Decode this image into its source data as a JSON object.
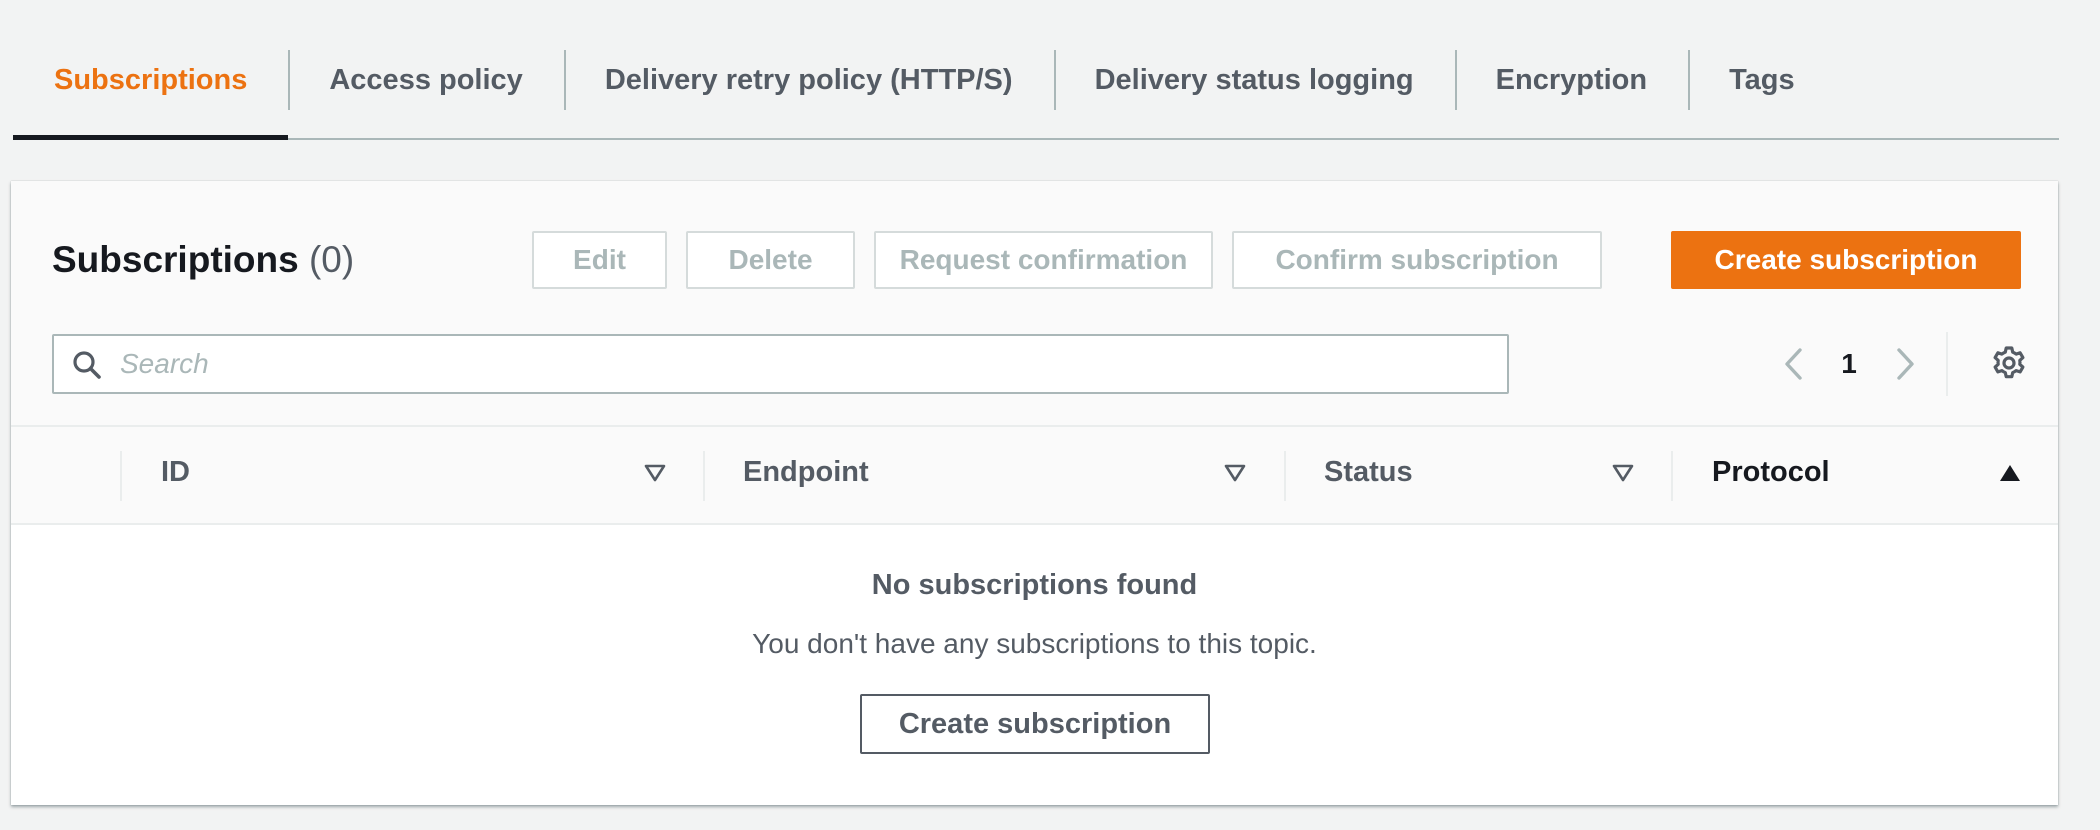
{
  "tabs": [
    {
      "label": "Subscriptions",
      "active": true
    },
    {
      "label": "Access policy",
      "active": false
    },
    {
      "label": "Delivery retry policy (HTTP/S)",
      "active": false
    },
    {
      "label": "Delivery status logging",
      "active": false
    },
    {
      "label": "Encryption",
      "active": false
    },
    {
      "label": "Tags",
      "active": false
    }
  ],
  "panel": {
    "title": "Subscriptions",
    "count": "(0)",
    "buttons": {
      "edit": "Edit",
      "delete": "Delete",
      "request_confirmation": "Request confirmation",
      "confirm_subscription": "Confirm subscription",
      "create_subscription": "Create subscription"
    },
    "search": {
      "placeholder": "Search",
      "value": ""
    },
    "pagination": {
      "current_page": "1"
    }
  },
  "table": {
    "columns": [
      {
        "label": "ID",
        "sort": "none"
      },
      {
        "label": "Endpoint",
        "sort": "none"
      },
      {
        "label": "Status",
        "sort": "none"
      },
      {
        "label": "Protocol",
        "sort": "ascending"
      }
    ]
  },
  "empty_state": {
    "title": "No subscriptions found",
    "description": "You don't have any subscriptions to this topic.",
    "button": "Create subscription"
  },
  "colors": {
    "accent": "#ec7211",
    "background": "#f2f3f3",
    "text": "#545b64",
    "text_dark": "#16191f",
    "disabled": "#aab7b8"
  },
  "icons": {
    "search": "search-icon",
    "prev": "chevron-left-icon",
    "next": "chevron-right-icon",
    "settings": "gear-icon",
    "sort_none": "caret-down-outline-icon",
    "sort_asc": "caret-up-filled-icon"
  }
}
